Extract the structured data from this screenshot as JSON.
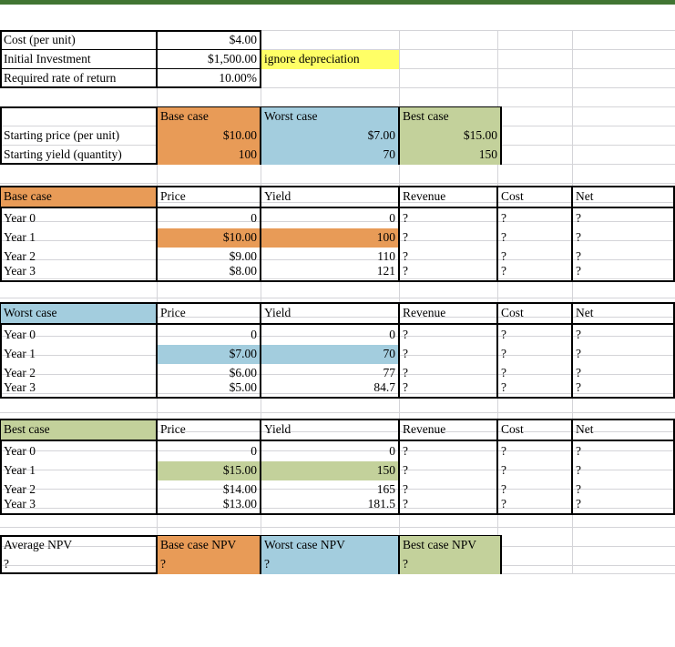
{
  "document": {
    "type": "spreadsheet",
    "top_band_color": "#417533",
    "colors": {
      "base_case": "#E89B57",
      "worst_case": "#A3CDDE",
      "best_case": "#C3D19B",
      "note": "#FFFF66",
      "gridline": "#d4d4d8",
      "border": "#000000"
    }
  },
  "assumptions": {
    "rows": [
      {
        "label": "Cost (per unit)",
        "value": "$4.00"
      },
      {
        "label": "Initial Investment",
        "value": "$1,500.00",
        "note": "ignore depreciation"
      },
      {
        "label": "Required rate of return",
        "value": "10.00%"
      }
    ]
  },
  "scenarios": {
    "header": {
      "corner": "",
      "base": "Base case",
      "worst": "Worst case",
      "best": "Best case"
    },
    "rows": [
      {
        "label": "Starting price (per unit)",
        "base": "$10.00",
        "worst": "$7.00",
        "best": "$15.00"
      },
      {
        "label": "Starting yield (quantity)",
        "base": "100",
        "worst": "70",
        "best": "150"
      }
    ]
  },
  "tables": [
    {
      "id": "base-case",
      "title": "Base case",
      "fill": "#E89B57",
      "columns": [
        "Price",
        "Yield",
        "Revenue",
        "Cost",
        "Net"
      ],
      "rows": [
        {
          "label": "Year 0",
          "price": "0",
          "yield": "0",
          "revenue": "?",
          "cost": "?",
          "net": "?",
          "highlight": false
        },
        {
          "label": "Year 1",
          "price": "$10.00",
          "yield": "100",
          "revenue": "?",
          "cost": "?",
          "net": "?",
          "highlight": true
        },
        {
          "label": "Year 2",
          "price": "$9.00",
          "yield": "110",
          "revenue": "?",
          "cost": "?",
          "net": "?",
          "highlight": false
        },
        {
          "label": "Year 3",
          "price": "$8.00",
          "yield": "121",
          "revenue": "?",
          "cost": "?",
          "net": "?",
          "highlight": false
        }
      ]
    },
    {
      "id": "worst-case",
      "title": "Worst case",
      "fill": "#A3CDDE",
      "columns": [
        "Price",
        "Yield",
        "Revenue",
        "Cost",
        "Net"
      ],
      "rows": [
        {
          "label": "Year 0",
          "price": "0",
          "yield": "0",
          "revenue": "?",
          "cost": "?",
          "net": "?",
          "highlight": false
        },
        {
          "label": "Year 1",
          "price": "$7.00",
          "yield": "70",
          "revenue": "?",
          "cost": "?",
          "net": "?",
          "highlight": true
        },
        {
          "label": "Year 2",
          "price": "$6.00",
          "yield": "77",
          "revenue": "?",
          "cost": "?",
          "net": "?",
          "highlight": false
        },
        {
          "label": "Year 3",
          "price": "$5.00",
          "yield": "84.7",
          "revenue": "?",
          "cost": "?",
          "net": "?",
          "highlight": false
        }
      ]
    },
    {
      "id": "best-case",
      "title": "Best case",
      "fill": "#C3D19B",
      "columns": [
        "Price",
        "Yield",
        "Revenue",
        "Cost",
        "Net"
      ],
      "rows": [
        {
          "label": "Year 0",
          "price": "0",
          "yield": "0",
          "revenue": "?",
          "cost": "?",
          "net": "?",
          "highlight": false
        },
        {
          "label": "Year 1",
          "price": "$15.00",
          "yield": "150",
          "revenue": "?",
          "cost": "?",
          "net": "?",
          "highlight": true
        },
        {
          "label": "Year 2",
          "price": "$14.00",
          "yield": "165",
          "revenue": "?",
          "cost": "?",
          "net": "?",
          "highlight": false
        },
        {
          "label": "Year 3",
          "price": "$13.00",
          "yield": "181.5",
          "revenue": "?",
          "cost": "?",
          "net": "?",
          "highlight": false
        }
      ]
    }
  ],
  "npv_summary": {
    "header": {
      "label": "Average NPV",
      "base": "Base case NPV",
      "worst": "Worst case NPV",
      "best": "Best case NPV"
    },
    "values": {
      "average": "?",
      "base": "?",
      "worst": "?",
      "best": "?"
    }
  }
}
